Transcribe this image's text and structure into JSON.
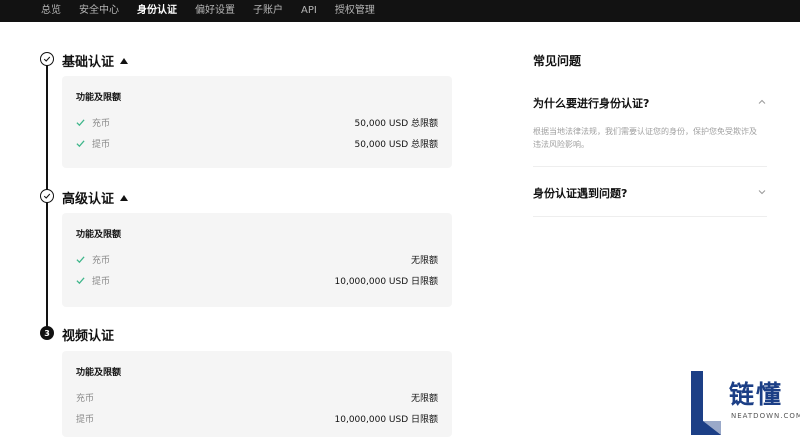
{
  "nav": {
    "items": [
      "总览",
      "安全中心",
      "身份认证",
      "偏好设置",
      "子账户",
      "API",
      "授权管理"
    ],
    "active_index": 2
  },
  "steps": [
    {
      "state": "done",
      "title": "基础认证",
      "card_title": "功能及限额",
      "rows": [
        {
          "label": "充币",
          "value": "50,000 USD 总限额",
          "checked": true
        },
        {
          "label": "提币",
          "value": "50,000 USD 总限额",
          "checked": true
        }
      ]
    },
    {
      "state": "done",
      "title": "高级认证",
      "card_title": "功能及限额",
      "rows": [
        {
          "label": "充币",
          "value": "无限额",
          "checked": true
        },
        {
          "label": "提币",
          "value": "10,000,000 USD 日限额",
          "checked": true
        }
      ]
    },
    {
      "state": "current",
      "number": "3",
      "title": "视频认证",
      "card_title": "功能及限额",
      "rows": [
        {
          "label": "充币",
          "value": "无限额",
          "checked": false
        },
        {
          "label": "提币",
          "value": "10,000,000 USD 日限额",
          "checked": false
        }
      ]
    }
  ],
  "faq": {
    "title": "常见问题",
    "items": [
      {
        "question": "为什么要进行身份认证?",
        "answer": "根据当地法律法规，我们需要认证您的身份，保护您免受欺诈及违法风险影响。",
        "expanded": true
      },
      {
        "question": "身份认证遇到问题?",
        "expanded": false
      }
    ]
  },
  "watermark": {
    "cn": "链懂",
    "en": "NEATDOWN.COM"
  },
  "colors": {
    "nav_bg": "#121212",
    "check_green": "#3fb68b",
    "card_bg": "#f5f5f5",
    "logo_blue": "#1c3f86"
  }
}
